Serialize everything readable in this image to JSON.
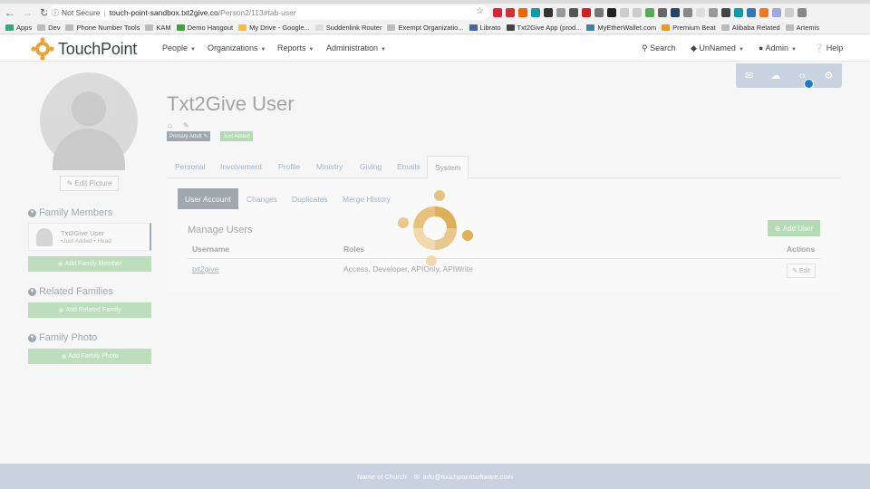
{
  "browser": {
    "security": "Not Secure",
    "url_host": "touch-point-sandbox.txt2give.co",
    "url_path": "/Person2/113#tab-user",
    "bookmarks": [
      "Apps",
      "Dev",
      "Phone Number Tools",
      "KAM",
      "Demo Hangout",
      "My Drive - Google...",
      "Suddenlink Router",
      "Exempt Organizatio...",
      "Librato",
      "Txt2Give App (prod...",
      "MyEtherWallet.com",
      "Premium Beat",
      "Alibaba Related",
      "Artemis"
    ]
  },
  "navbar": {
    "brand": "TouchPoint",
    "menu": [
      "People",
      "Organizations",
      "Reports",
      "Administration"
    ],
    "search": "Search",
    "unnamed": "UnNamed",
    "admin": "Admin",
    "help": "Help"
  },
  "profile": {
    "name": "Txt2Give User",
    "badge_primary": "Primary Adult",
    "badge_status": "Just Added",
    "edit_picture": "Edit Picture"
  },
  "sidebar": {
    "family_members": "Family Members",
    "member_name": "Txt2Give User",
    "member_role": "•Just Added • Head",
    "add_family_member": "Add Family Member",
    "related_families": "Related Families",
    "add_related_family": "Add Related Family",
    "family_photo": "Family Photo",
    "add_family_photo": "Add Family Photo"
  },
  "tabs": [
    "Personal",
    "Involvement",
    "Profile",
    "Ministry",
    "Giving",
    "Emails",
    "System"
  ],
  "subtabs": [
    "User Account",
    "Changes",
    "Duplicates",
    "Merge History"
  ],
  "users": {
    "title": "Manage Users",
    "add_user": "Add User",
    "col_username": "Username",
    "col_roles": "Roles",
    "col_actions": "Actions",
    "row_username": "txt2give",
    "row_roles": "Access, Developer, APIOnly, APIWrite",
    "row_edit": "Edit"
  },
  "footer": {
    "church": "Name of Church",
    "email": "info@touchpointsoftware.com"
  },
  "colors": {
    "brand_orange": "#e8a33a",
    "navy": "#2a3b4f",
    "green": "#5cb85c",
    "toolbar": "#c9d3df"
  }
}
